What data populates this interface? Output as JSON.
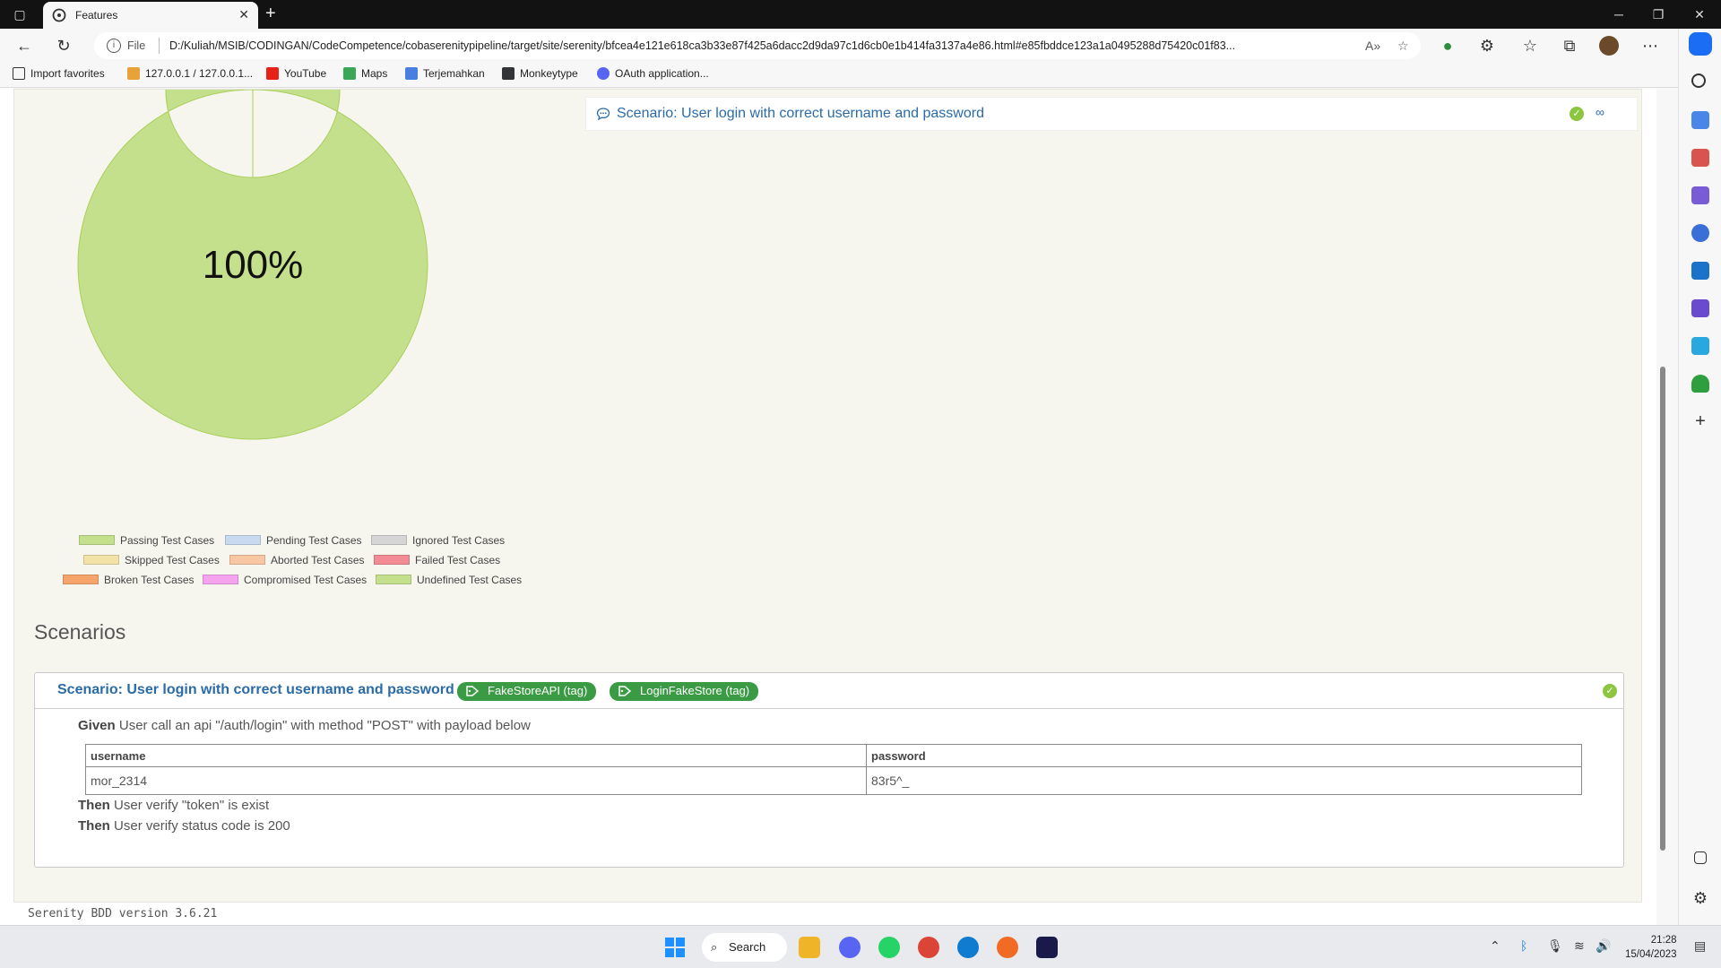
{
  "browser": {
    "tab_title": "Features",
    "new_tab": "+",
    "url_scheme": "File",
    "url": "D:/Kuliah/MSIB/CODINGAN/CodeCompetence/cobaserenitypipeline/target/site/serenity/bfcea4e121e618ca3b33e87f425a6dacc2d9da97c1d6cb0e1b414fa3137a4e86.html#e85fbddce123a1a0495288d75420c01f83...",
    "bookmarks": [
      "Import favorites",
      "127.0.0.1 / 127.0.0.1...",
      "YouTube",
      "Maps",
      "Terjemahkan",
      "Monkeytype",
      "OAuth application..."
    ]
  },
  "report": {
    "scenario_list_item": "Scenario: User login with correct username and password",
    "pie_percent": "100%",
    "legend": [
      "Passing Test Cases",
      "Pending Test Cases",
      "Ignored Test Cases",
      "Skipped Test Cases",
      "Aborted Test Cases",
      "Failed Test Cases",
      "Broken Test Cases",
      "Compromised Test Cases",
      "Undefined Test Cases"
    ],
    "section_title": "Scenarios",
    "scenario": {
      "title": "Scenario: User login with correct username and password",
      "tags": [
        "FakeStoreAPI (tag)",
        "LoginFakeStore (tag)"
      ],
      "given_keyword": "Given",
      "given_text": "User call an api \"/auth/login\" with method \"POST\" with payload below",
      "table_headers": [
        "username",
        "password"
      ],
      "table_row": [
        "mor_2314",
        "83r5^_"
      ],
      "then_keyword": "Then",
      "then1_text": "User verify \"token\" is exist",
      "then2_text": "User verify status code is 200"
    },
    "footer": "Serenity BDD version 3.6.21"
  },
  "chart_data": {
    "type": "pie",
    "categories": [
      "Passing Test Cases"
    ],
    "values": [
      100
    ],
    "label": "100%"
  },
  "taskbar": {
    "search_label": "Search",
    "time": "21:28",
    "date": "15/04/2023"
  }
}
